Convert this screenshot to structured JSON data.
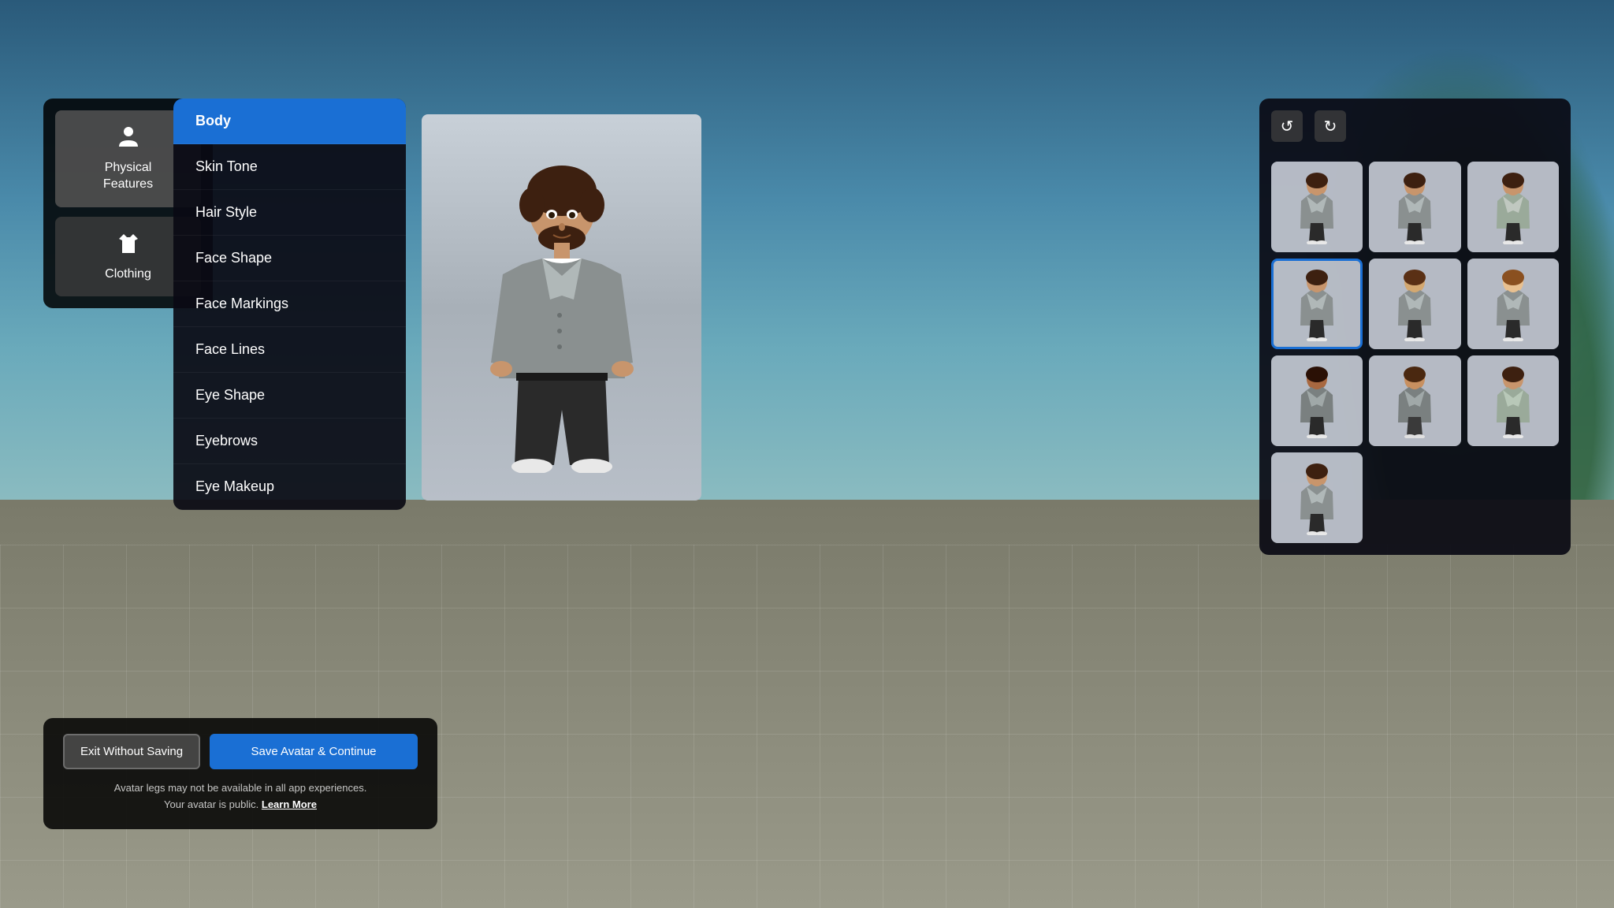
{
  "background": {
    "has_sky": true,
    "has_ground": true,
    "has_trees": true
  },
  "left_panel": {
    "categories": [
      {
        "id": "physical-features",
        "label": "Physical\nFeatures",
        "icon": "👤",
        "active": true
      },
      {
        "id": "clothing",
        "label": "Clothing",
        "icon": "👕",
        "active": false
      }
    ]
  },
  "middle_panel": {
    "menu_items": [
      {
        "id": "body",
        "label": "Body",
        "selected": true
      },
      {
        "id": "skin-tone",
        "label": "Skin Tone",
        "selected": false
      },
      {
        "id": "hair-style",
        "label": "Hair Style",
        "selected": false
      },
      {
        "id": "face-shape",
        "label": "Face Shape",
        "selected": false
      },
      {
        "id": "face-markings",
        "label": "Face Markings",
        "selected": false
      },
      {
        "id": "face-lines",
        "label": "Face Lines",
        "selected": false
      },
      {
        "id": "eye-shape",
        "label": "Eye Shape",
        "selected": false
      },
      {
        "id": "eyebrows",
        "label": "Eyebrows",
        "selected": false
      },
      {
        "id": "eye-makeup",
        "label": "Eye Makeup",
        "selected": false
      }
    ]
  },
  "bottom_area": {
    "exit_button_label": "Exit Without Saving",
    "save_button_label": "Save Avatar & Continue",
    "notice_line1": "Avatar legs may not be available in all app experiences.",
    "notice_line2": "Your avatar is public.",
    "learn_more_label": "Learn More"
  },
  "right_panel": {
    "undo_label": "↺",
    "redo_label": "↻",
    "avatar_count": 10,
    "selected_index": 3,
    "grid_columns": 3
  },
  "colors": {
    "selected_border": "#1a6fd4",
    "active_menu_bg": "#1a6fd4",
    "panel_bg": "rgba(10,10,20,0.92)",
    "preview_bg": "#c8d0d8"
  }
}
